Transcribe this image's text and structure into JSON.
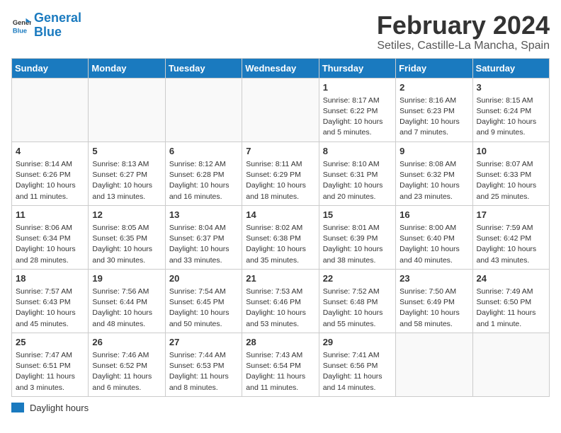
{
  "logo": {
    "line1": "General",
    "line2": "Blue"
  },
  "title": "February 2024",
  "subtitle": "Setiles, Castille-La Mancha, Spain",
  "days_of_week": [
    "Sunday",
    "Monday",
    "Tuesday",
    "Wednesday",
    "Thursday",
    "Friday",
    "Saturday"
  ],
  "weeks": [
    [
      {
        "day": "",
        "info": ""
      },
      {
        "day": "",
        "info": ""
      },
      {
        "day": "",
        "info": ""
      },
      {
        "day": "",
        "info": ""
      },
      {
        "day": "1",
        "info": "Sunrise: 8:17 AM\nSunset: 6:22 PM\nDaylight: 10 hours\nand 5 minutes."
      },
      {
        "day": "2",
        "info": "Sunrise: 8:16 AM\nSunset: 6:23 PM\nDaylight: 10 hours\nand 7 minutes."
      },
      {
        "day": "3",
        "info": "Sunrise: 8:15 AM\nSunset: 6:24 PM\nDaylight: 10 hours\nand 9 minutes."
      }
    ],
    [
      {
        "day": "4",
        "info": "Sunrise: 8:14 AM\nSunset: 6:26 PM\nDaylight: 10 hours\nand 11 minutes."
      },
      {
        "day": "5",
        "info": "Sunrise: 8:13 AM\nSunset: 6:27 PM\nDaylight: 10 hours\nand 13 minutes."
      },
      {
        "day": "6",
        "info": "Sunrise: 8:12 AM\nSunset: 6:28 PM\nDaylight: 10 hours\nand 16 minutes."
      },
      {
        "day": "7",
        "info": "Sunrise: 8:11 AM\nSunset: 6:29 PM\nDaylight: 10 hours\nand 18 minutes."
      },
      {
        "day": "8",
        "info": "Sunrise: 8:10 AM\nSunset: 6:31 PM\nDaylight: 10 hours\nand 20 minutes."
      },
      {
        "day": "9",
        "info": "Sunrise: 8:08 AM\nSunset: 6:32 PM\nDaylight: 10 hours\nand 23 minutes."
      },
      {
        "day": "10",
        "info": "Sunrise: 8:07 AM\nSunset: 6:33 PM\nDaylight: 10 hours\nand 25 minutes."
      }
    ],
    [
      {
        "day": "11",
        "info": "Sunrise: 8:06 AM\nSunset: 6:34 PM\nDaylight: 10 hours\nand 28 minutes."
      },
      {
        "day": "12",
        "info": "Sunrise: 8:05 AM\nSunset: 6:35 PM\nDaylight: 10 hours\nand 30 minutes."
      },
      {
        "day": "13",
        "info": "Sunrise: 8:04 AM\nSunset: 6:37 PM\nDaylight: 10 hours\nand 33 minutes."
      },
      {
        "day": "14",
        "info": "Sunrise: 8:02 AM\nSunset: 6:38 PM\nDaylight: 10 hours\nand 35 minutes."
      },
      {
        "day": "15",
        "info": "Sunrise: 8:01 AM\nSunset: 6:39 PM\nDaylight: 10 hours\nand 38 minutes."
      },
      {
        "day": "16",
        "info": "Sunrise: 8:00 AM\nSunset: 6:40 PM\nDaylight: 10 hours\nand 40 minutes."
      },
      {
        "day": "17",
        "info": "Sunrise: 7:59 AM\nSunset: 6:42 PM\nDaylight: 10 hours\nand 43 minutes."
      }
    ],
    [
      {
        "day": "18",
        "info": "Sunrise: 7:57 AM\nSunset: 6:43 PM\nDaylight: 10 hours\nand 45 minutes."
      },
      {
        "day": "19",
        "info": "Sunrise: 7:56 AM\nSunset: 6:44 PM\nDaylight: 10 hours\nand 48 minutes."
      },
      {
        "day": "20",
        "info": "Sunrise: 7:54 AM\nSunset: 6:45 PM\nDaylight: 10 hours\nand 50 minutes."
      },
      {
        "day": "21",
        "info": "Sunrise: 7:53 AM\nSunset: 6:46 PM\nDaylight: 10 hours\nand 53 minutes."
      },
      {
        "day": "22",
        "info": "Sunrise: 7:52 AM\nSunset: 6:48 PM\nDaylight: 10 hours\nand 55 minutes."
      },
      {
        "day": "23",
        "info": "Sunrise: 7:50 AM\nSunset: 6:49 PM\nDaylight: 10 hours\nand 58 minutes."
      },
      {
        "day": "24",
        "info": "Sunrise: 7:49 AM\nSunset: 6:50 PM\nDaylight: 11 hours\nand 1 minute."
      }
    ],
    [
      {
        "day": "25",
        "info": "Sunrise: 7:47 AM\nSunset: 6:51 PM\nDaylight: 11 hours\nand 3 minutes."
      },
      {
        "day": "26",
        "info": "Sunrise: 7:46 AM\nSunset: 6:52 PM\nDaylight: 11 hours\nand 6 minutes."
      },
      {
        "day": "27",
        "info": "Sunrise: 7:44 AM\nSunset: 6:53 PM\nDaylight: 11 hours\nand 8 minutes."
      },
      {
        "day": "28",
        "info": "Sunrise: 7:43 AM\nSunset: 6:54 PM\nDaylight: 11 hours\nand 11 minutes."
      },
      {
        "day": "29",
        "info": "Sunrise: 7:41 AM\nSunset: 6:56 PM\nDaylight: 11 hours\nand 14 minutes."
      },
      {
        "day": "",
        "info": ""
      },
      {
        "day": "",
        "info": ""
      }
    ]
  ],
  "legend": {
    "daylight_label": "Daylight hours"
  }
}
